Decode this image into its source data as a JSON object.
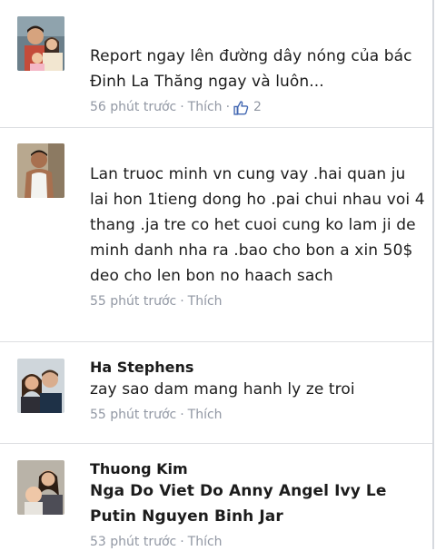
{
  "comments": [
    {
      "author": "",
      "text": "Report ngay lên đường dây nóng của bác Đinh La Thăng ngay và luôn...",
      "time": "56 phút trước",
      "separator": "·",
      "like_label": "Thích",
      "like_count": "2",
      "avatar_icon": "user-photo-family"
    },
    {
      "author": "",
      "text": "Lan truoc minh vn cung vay .hai quan ju lai hon 1tieng dong ho .pai chui nhau voi 4 thang .ja tre co het cuoi cung ko lam ji de minh danh nha ra .bao cho bon a xin 50$ deo cho len bon no haach sach",
      "time": "55 phút trước",
      "separator": "·",
      "like_label": "Thích",
      "avatar_icon": "user-photo-man"
    },
    {
      "author": "Ha Stephens",
      "text": "zay sao dam mang hanh ly ze troi",
      "time": "55 phút trước",
      "separator": "·",
      "like_label": "Thích",
      "avatar_icon": "user-photo-couple"
    },
    {
      "author": "Thuong Kim",
      "text": "Nga Do Viet Do Anny Angel Ivy Le Putin Nguyen Binh Jar",
      "time": "53 phút trước",
      "separator": "·",
      "like_label": "Thích",
      "avatar_icon": "user-photo-mother-child"
    }
  ],
  "colors": {
    "meta": "#9197a3",
    "like_icon": "#4267b2",
    "divider": "#dddfe2"
  }
}
